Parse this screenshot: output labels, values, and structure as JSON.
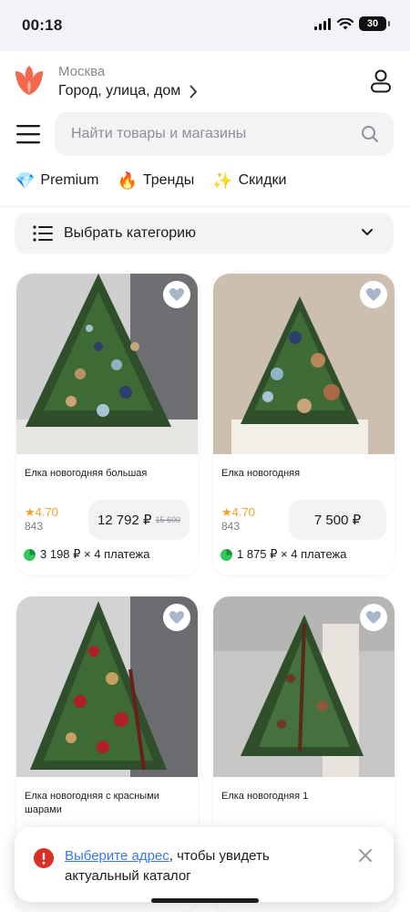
{
  "status_bar": {
    "time": "00:18",
    "battery": "30",
    "icons": [
      "cellular-signal-icon",
      "wifi-icon",
      "battery-icon"
    ]
  },
  "header": {
    "city": "Москва",
    "address": "Город, улица, дом",
    "search_placeholder": "Найти товары и магазины",
    "quick_links": [
      {
        "icon": "💎",
        "label": "Premium"
      },
      {
        "icon": "🔥",
        "label": "Тренды"
      },
      {
        "icon": "✨",
        "label": "Скидки"
      }
    ]
  },
  "category_select": {
    "label": "Выбрать категорию"
  },
  "products": [
    {
      "title": "Елка новогодняя большая",
      "rating": "4.70",
      "reviews": "843",
      "price": "12 792 ₽",
      "old_price": "15 600",
      "installment": "3 198 ₽ × 4 платежа"
    },
    {
      "title": "Елка новогодняя",
      "rating": "4.70",
      "reviews": "843",
      "price": "7 500 ₽",
      "installment": "1 875 ₽ × 4 платежа"
    },
    {
      "title": "Елка новогодняя с красными шарами"
    },
    {
      "title": "Елка новогодняя 1"
    }
  ],
  "toast": {
    "link_text": "Выберите адрес",
    "text": ", чтобы увидеть актуальный каталог"
  },
  "colors": {
    "accent_red": "#f4694e",
    "link_blue": "#3478f6",
    "rating_orange": "#f3a020",
    "installment_green": "#34c759",
    "alert_red": "#d93025"
  }
}
